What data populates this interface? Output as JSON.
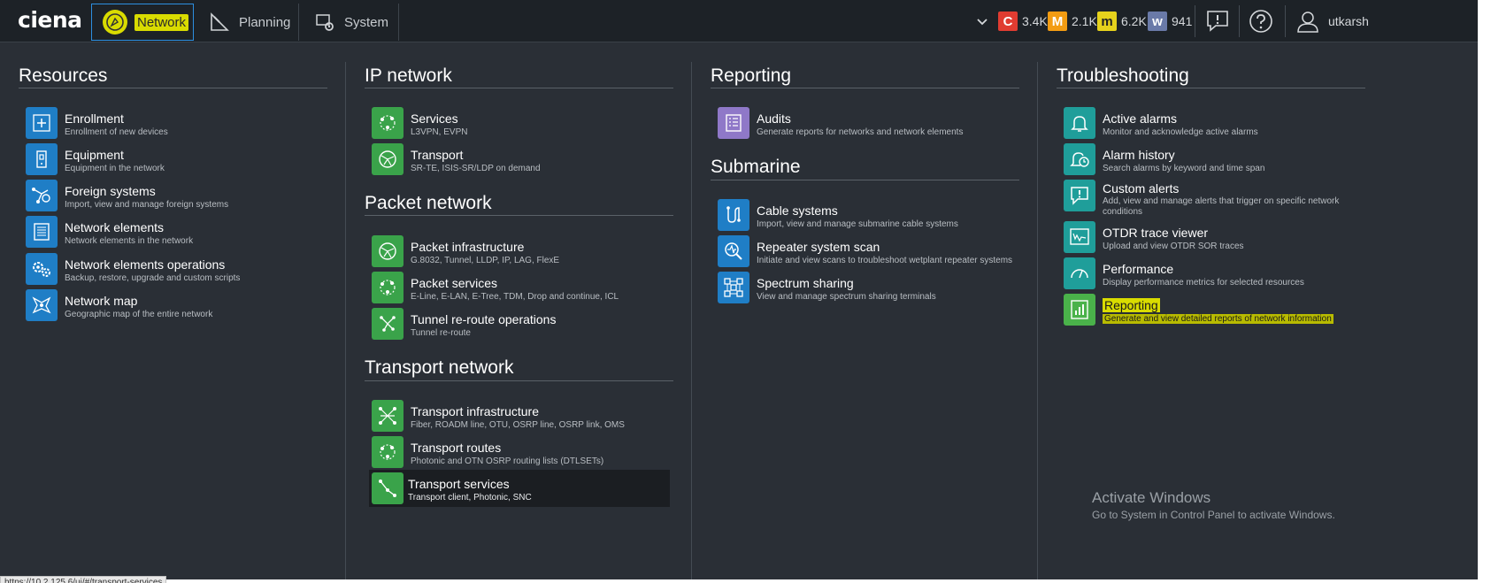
{
  "header": {
    "logo": "ciena",
    "tabs": [
      {
        "label": "Network",
        "icon": "network-compass-icon",
        "active": true
      },
      {
        "label": "Planning",
        "icon": "planning-icon",
        "active": false
      },
      {
        "label": "System",
        "icon": "system-gear-icon",
        "active": false
      }
    ],
    "alarms": [
      {
        "letter": "C",
        "count": "3.4K",
        "color": "#e03c31"
      },
      {
        "letter": "M",
        "count": "2.1K",
        "color": "#f39c12"
      },
      {
        "letter": "m",
        "count": "6.2K",
        "color": "#e6d21c"
      },
      {
        "letter": "w",
        "count": "941",
        "color": "#6a7aa8"
      }
    ],
    "user": "utkarsh"
  },
  "columns": [
    {
      "sections": [
        {
          "title": "Resources",
          "items": [
            {
              "title": "Enrollment",
              "sub": "Enrollment of new devices",
              "icon": "plus-icon",
              "color": "blue"
            },
            {
              "title": "Equipment",
              "sub": "Equipment in the network",
              "icon": "device-icon",
              "color": "blue"
            },
            {
              "title": "Foreign systems",
              "sub": "Import, view and manage foreign systems",
              "icon": "foreign-systems-icon",
              "color": "blue"
            },
            {
              "title": "Network elements",
              "sub": "Network elements in the network",
              "icon": "network-element-icon",
              "color": "blue"
            },
            {
              "title": "Network elements operations",
              "sub": "Backup, restore, upgrade and custom scripts",
              "icon": "gears-icon",
              "color": "blue"
            },
            {
              "title": "Network map",
              "sub": "Geographic map of the entire network",
              "icon": "network-map-icon",
              "color": "blue"
            }
          ]
        }
      ]
    },
    {
      "sections": [
        {
          "title": "IP network",
          "items": [
            {
              "title": "Services",
              "sub": "L3VPN, EVPN",
              "icon": "services-icon",
              "color": "green"
            },
            {
              "title": "Transport",
              "sub": "SR-TE, ISIS-SR/LDP on demand",
              "icon": "globe-icon",
              "color": "green"
            }
          ]
        },
        {
          "title": "Packet network",
          "items": [
            {
              "title": "Packet infrastructure",
              "sub": "G.8032, Tunnel, LLDP, IP, LAG, FlexE",
              "icon": "globe-icon",
              "color": "green"
            },
            {
              "title": "Packet services",
              "sub": "E-Line, E-LAN, E-Tree, TDM, Drop and continue, ICL",
              "icon": "services-icon",
              "color": "green"
            },
            {
              "title": "Tunnel re-route operations",
              "sub": "Tunnel re-route",
              "icon": "reroute-icon",
              "color": "green"
            }
          ]
        },
        {
          "title": "Transport network",
          "items": [
            {
              "title": "Transport infrastructure",
              "sub": "Fiber, ROADM line, OTU, OSRP line, OSRP link, OMS",
              "icon": "topology-icon",
              "color": "green"
            },
            {
              "title": "Transport routes",
              "sub": "Photonic and OTN OSRP routing lists (DTLSETs)",
              "icon": "services-icon",
              "color": "green"
            },
            {
              "title": "Transport services",
              "sub": "Transport client, Photonic, SNC",
              "icon": "route-line-icon",
              "color": "green",
              "selected": true
            }
          ]
        }
      ]
    },
    {
      "sections": [
        {
          "title": "Reporting",
          "items": [
            {
              "title": "Audits",
              "sub": "Generate reports for networks and network elements",
              "icon": "audit-checklist-icon",
              "color": "purple"
            }
          ]
        },
        {
          "title": "Submarine",
          "items": [
            {
              "title": "Cable systems",
              "sub": "Import, view and manage submarine cable systems",
              "icon": "cable-icon",
              "color": "blue"
            },
            {
              "title": "Repeater system scan",
              "sub": "Initiate and view scans to troubleshoot wetplant repeater systems",
              "icon": "scan-icon",
              "color": "blue"
            },
            {
              "title": "Spectrum sharing",
              "sub": "View and manage spectrum sharing terminals",
              "icon": "spectrum-icon",
              "color": "blue"
            }
          ]
        }
      ]
    },
    {
      "sections": [
        {
          "title": "Troubleshooting",
          "items": [
            {
              "title": "Active alarms",
              "sub": "Monitor and acknowledge active alarms",
              "icon": "bell-icon",
              "color": "teal"
            },
            {
              "title": "Alarm history",
              "sub": "Search alarms by keyword and time span",
              "icon": "bell-history-icon",
              "color": "teal"
            },
            {
              "title": "Custom alerts",
              "sub": "Add, view and manage alerts that trigger on specific network",
              "sub2": "conditions",
              "icon": "alert-icon",
              "color": "teal"
            },
            {
              "title": "OTDR trace viewer",
              "sub": "Upload and view OTDR SOR traces",
              "icon": "otdr-icon",
              "color": "teal"
            },
            {
              "title": "Performance",
              "sub": "Display performance metrics for selected resources",
              "icon": "gauge-icon",
              "color": "teal"
            },
            {
              "title": "Reporting",
              "sub": "Generate and view detailed reports of network information",
              "icon": "report-chart-icon",
              "color": "green",
              "highlighted": true
            }
          ]
        }
      ]
    }
  ],
  "watermark": {
    "line1": "Activate Windows",
    "line2": "Go to System in Control Panel to activate Windows."
  },
  "status_url": "https://10.2.125.6/ui/#/transport-services"
}
